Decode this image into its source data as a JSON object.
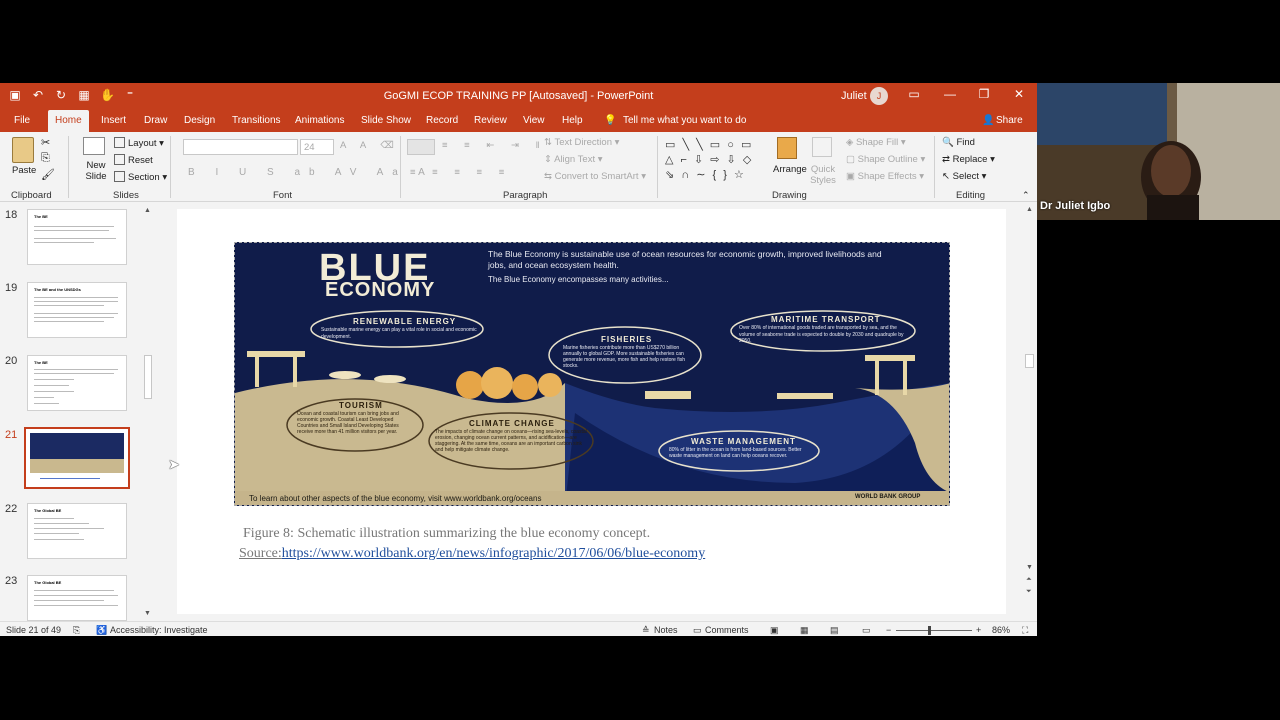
{
  "app": {
    "doc_title": "GoGMI ECOP TRAINING PP [Autosaved] - PowerPoint",
    "user_name": "Juliet",
    "user_initial": "J"
  },
  "tabs": [
    "File",
    "Home",
    "Insert",
    "Draw",
    "Design",
    "Transitions",
    "Animations",
    "Slide Show",
    "Record",
    "Review",
    "View",
    "Help"
  ],
  "tell_me": "Tell me what you want to do",
  "share_label": "Share",
  "ribbon": {
    "clipboard": {
      "paste": "Paste",
      "label": "Clipboard"
    },
    "slides": {
      "new_slide": "New Slide",
      "layout": "Layout",
      "reset": "Reset",
      "section": "Section",
      "label": "Slides"
    },
    "font": {
      "size": "24",
      "label": "Font"
    },
    "paragraph": {
      "text_direction": "Text Direction",
      "align_text": "Align Text",
      "smartart": "Convert to SmartArt",
      "label": "Paragraph"
    },
    "drawing": {
      "arrange": "Arrange",
      "quick_styles": "Quick Styles",
      "shape_fill": "Shape Fill",
      "shape_outline": "Shape Outline",
      "shape_effects": "Shape Effects",
      "label": "Drawing"
    },
    "editing": {
      "find": "Find",
      "replace": "Replace",
      "select": "Select",
      "label": "Editing"
    }
  },
  "thumbnails": [
    {
      "num": "18",
      "title": "The BE"
    },
    {
      "num": "19",
      "title": "The BE and the UNSDGs"
    },
    {
      "num": "20",
      "title": "The BE"
    },
    {
      "num": "21",
      "title": ""
    },
    {
      "num": "22",
      "title": "The Global BE"
    },
    {
      "num": "23",
      "title": "The Global BE"
    }
  ],
  "infographic": {
    "heading_1": "BLUE",
    "heading_2": "ECONOMY",
    "intro": "The Blue Economy is sustainable use of ocean resources for economic growth, improved livelihoods and jobs, and ocean ecosystem health.",
    "intro_2": "The Blue Economy encompasses many activities...",
    "renewable_title": "RENEWABLE ENERGY",
    "renewable_text": "Sustainable marine energy can play a vital role in social and economic development.",
    "fisheries_title": "FISHERIES",
    "fisheries_text": "Marine fisheries contribute more than US$270 billion annually to global GDP. More sustainable fisheries can generate more revenue, more fish and help restore fish stocks.",
    "maritime_title": "MARITIME TRANSPORT",
    "maritime_text": "Over 80% of international goods traded are transported by sea, and the volume of seaborne trade is expected to double by 2030 and quadruple by 2050.",
    "tourism_title": "TOURISM",
    "tourism_text": "Ocean and coastal tourism can bring jobs and economic growth. Coastal Least Developed Countries and Small Island Developing States receive more than 41 million visitors per year.",
    "climate_title": "CLIMATE CHANGE",
    "climate_text": "The impacts of climate change on oceans—rising sea-levels, coastal erosion, changing ocean current patterns, and acidification—are staggering. At the same time, oceans are an important carbon sink and help mitigate climate change.",
    "waste_title": "WASTE MANAGEMENT",
    "waste_text": "80% of litter in the ocean is from land-based sources. Better waste management on land can help oceans recover.",
    "footer": "To learn about other aspects of the blue economy, visit www.worldbank.org/oceans",
    "logo": "WORLD BANK GROUP"
  },
  "caption": "Figure 8: Schematic illustration summarizing the blue economy concept.",
  "source_prefix": "Source:",
  "source_link": "https://www.worldbank.org/en/news/infographic/2017/06/06/blue-economy",
  "status": {
    "slide": "Slide 21 of 49",
    "accessibility": "Accessibility: Investigate",
    "notes": "Notes",
    "comments": "Comments",
    "zoom": "86%"
  },
  "webcam": {
    "name": "Dr Juliet Igbo"
  },
  "colors": {
    "ppt_accent": "#c43e1c",
    "ocean": "#0e1a45",
    "link": "#1f4e9c"
  }
}
